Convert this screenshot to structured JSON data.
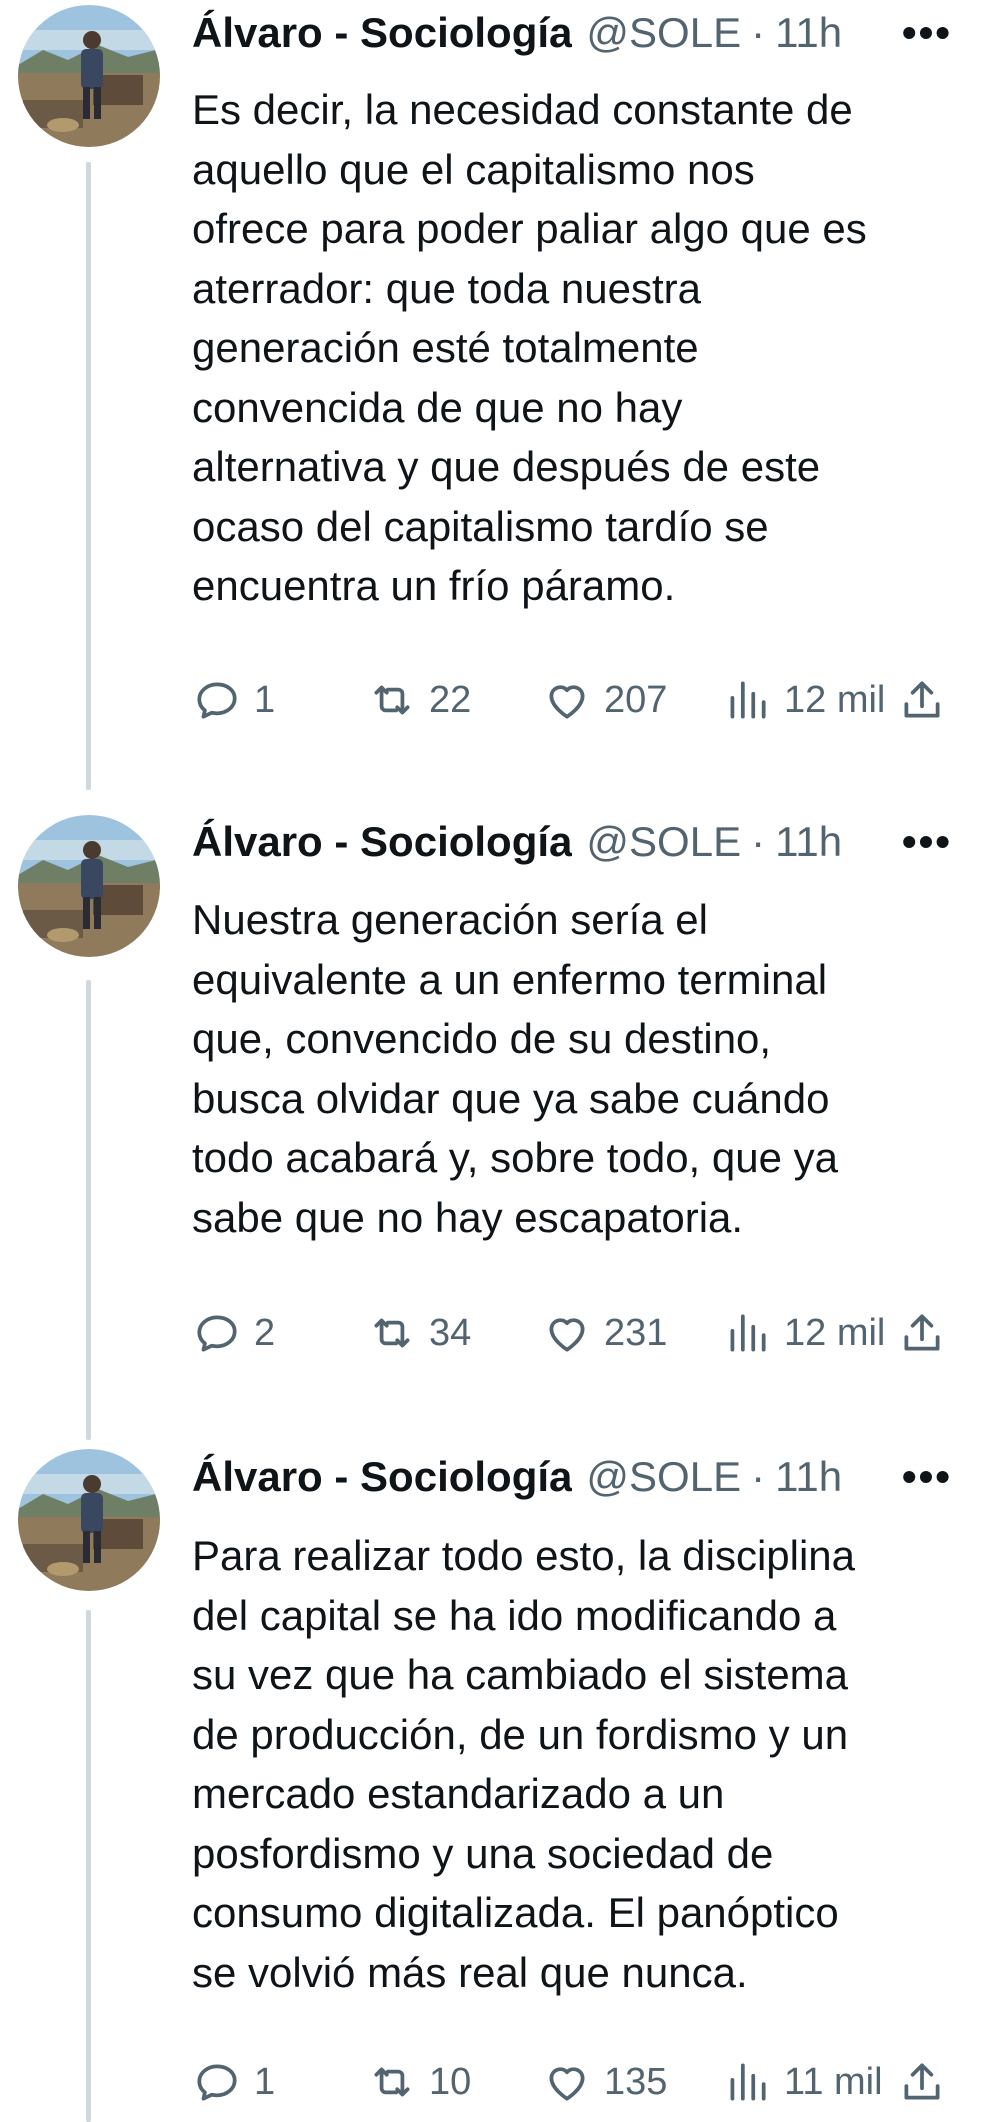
{
  "tweets": [
    {
      "author": "Álvaro - Sociología",
      "handle": "@SOLE",
      "separator": "·",
      "time": "11h",
      "more": "•••",
      "text": "Es decir, la necesidad constante de\naquello que el capitalismo nos\nofrece para poder paliar algo que es\naterrador: que toda nuestra\ngeneración esté totalmente\nconvencida de que no hay\nalternativa y que después de este\nocaso del capitalismo tardío se\nencuentra un frío páramo.",
      "replies": "1",
      "retweets": "22",
      "likes": "207",
      "views": "12 mil"
    },
    {
      "author": "Álvaro - Sociología",
      "handle": "@SOLE",
      "separator": "·",
      "time": "11h",
      "more": "•••",
      "text": "Nuestra generación sería el\nequivalente a un enfermo terminal\nque, convencido de su destino,\nbusca olvidar que ya sabe cuándo\ntodo acabará y, sobre todo, que ya\nsabe que no hay escapatoria.",
      "replies": "2",
      "retweets": "34",
      "likes": "231",
      "views": "12 mil"
    },
    {
      "author": "Álvaro - Sociología",
      "handle": "@SOLE",
      "separator": "·",
      "time": "11h",
      "more": "•••",
      "text": "Para realizar todo esto, la disciplina\ndel capital se ha ido modificando a\nsu vez que ha cambiado el sistema\nde producción, de un fordismo y un\nmercado estandarizado a un\nposfordismo y una sociedad de\nconsumo digitalizada. El panóptico\nse volvió más real que nunca.",
      "replies": "1",
      "retweets": "10",
      "likes": "135",
      "views": "11 mil"
    }
  ],
  "icons": {
    "reply": "reply-icon",
    "retweet": "retweet-icon",
    "like": "heart-icon",
    "views": "views-icon",
    "share": "share-icon"
  },
  "colors": {
    "text": "#0f1419",
    "secondary": "#536471",
    "thread_line": "#cfd9de"
  }
}
